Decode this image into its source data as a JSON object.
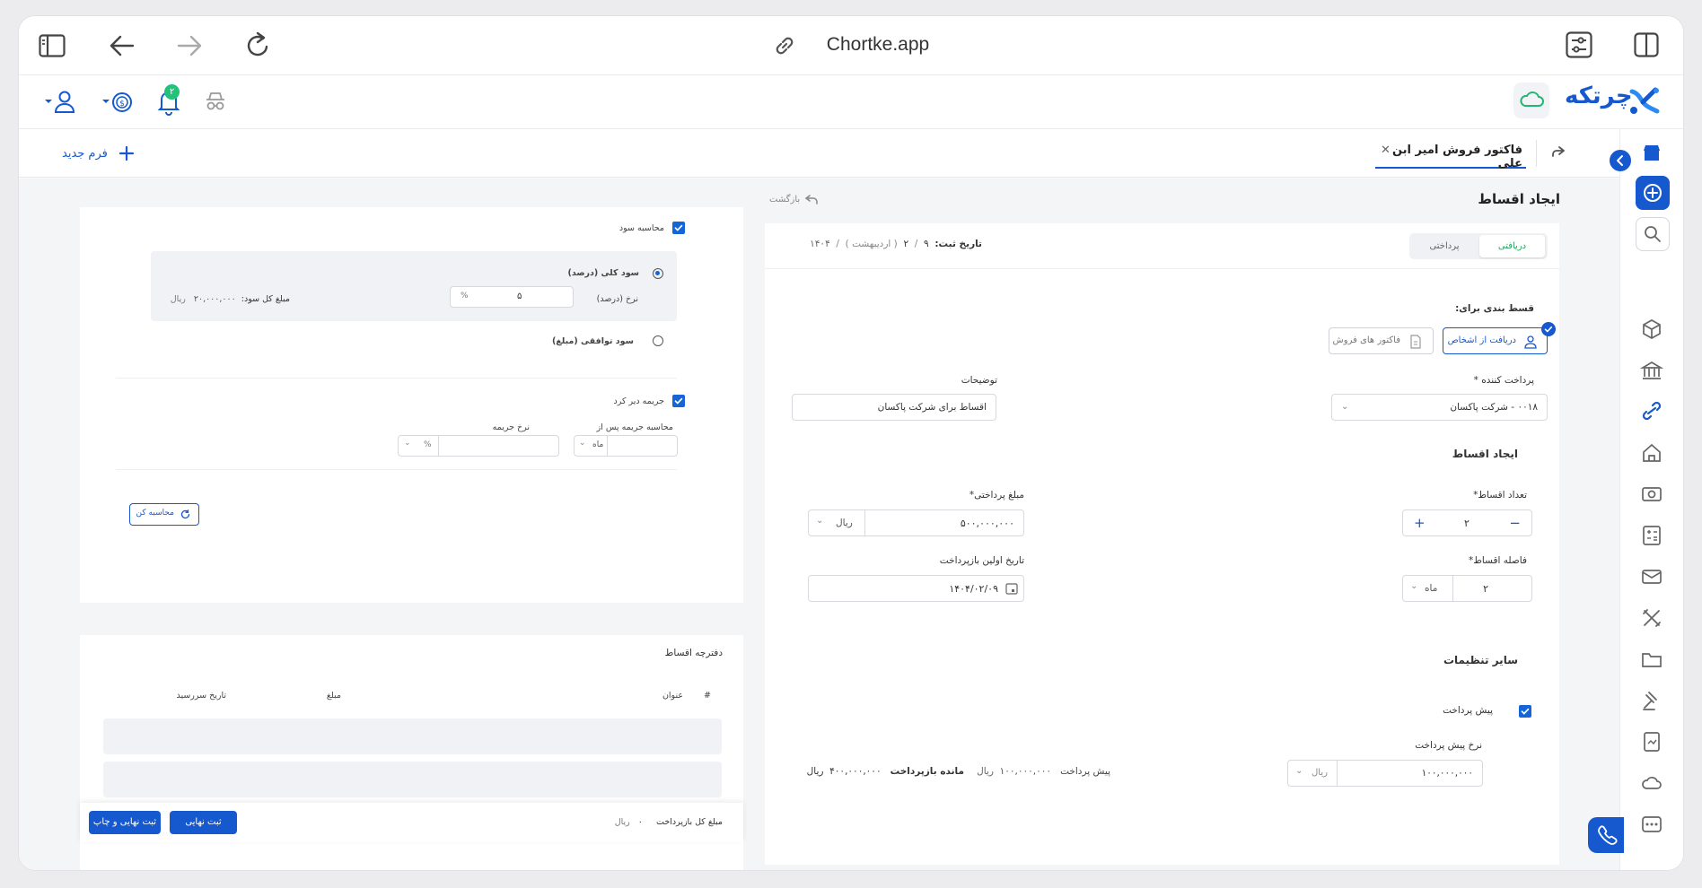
{
  "browser": {
    "url": "Chortke.app"
  },
  "app": {
    "logo_text": "چرتکه",
    "notification_badge": "۲",
    "colors": {
      "primary": "#1659cf",
      "accent": "#2b8bf0",
      "success": "#22b573"
    }
  },
  "tabs": {
    "active_label": "فاکتور فروش امیر ابن علی",
    "new_form_label": "فرم جدید"
  },
  "page": {
    "title": "ایجاد اقساط",
    "back_label": "بازگشت"
  },
  "main_form": {
    "segment": {
      "received": "دریافتی",
      "paid": "پرداختی"
    },
    "date": {
      "label": "تاریخ ثبت:",
      "day": "۹",
      "sep1": "/",
      "month": "۲",
      "month_name": "( اردیبهشت )",
      "sep2": "/",
      "year": "۱۴۰۴"
    },
    "installment_for": {
      "label": "قسط بندی برای:",
      "option_persons": "دریافت از اشخاص",
      "option_invoices": "فاکتور های فروش"
    },
    "payer": {
      "label": "پرداخت کننده *",
      "value": "۰۰۱۸ - شرکت پاکسان"
    },
    "description": {
      "label": "توضیحات",
      "value": "اقساط برای شرکت پاکسان"
    },
    "create_section_title": "ایجاد اقساط",
    "count": {
      "label": "تعداد اقساط*",
      "value": "۲"
    },
    "amount": {
      "label": "مبلغ پرداختی*",
      "value": "۵۰۰,۰۰۰,۰۰۰",
      "unit": "ریال"
    },
    "interval": {
      "label": "فاصله اقساط*",
      "value": "۲",
      "unit": "ماه"
    },
    "first_due": {
      "label": "تاریخ اولین بازپرداخت",
      "value": "۱۴۰۴/۰۲/۰۹"
    },
    "other_settings_title": "سایر تنظیمات",
    "prepayment": {
      "label": "پیش پرداخت"
    },
    "prepayment_rate": {
      "label": "نرخ پیش پرداخت",
      "value": "۱۰۰,۰۰۰,۰۰۰",
      "unit": "ریال"
    },
    "summary": {
      "prepay_label": "پیش پرداخت",
      "prepay_value": "۱۰۰,۰۰۰,۰۰۰",
      "prepay_unit": "ریال",
      "remaining_label": "مانده بازپرداخت",
      "remaining_value": "۴۰۰,۰۰۰,۰۰۰",
      "remaining_unit": "ریال"
    }
  },
  "profit_panel": {
    "calc_profit_label": "محاسبه سود",
    "total_profit_label": "سود کلی (درصد)",
    "rate_label": "نرخ (درصد)",
    "rate_value": "۵",
    "rate_unit": "%",
    "total_profit_amount_label": "مبلغ کل سود:",
    "total_profit_amount_value": "۲۰,۰۰۰,۰۰۰",
    "total_profit_amount_unit": "ریال",
    "agreed_profit_label": "سود توافقی (مبلغ)",
    "late_penalty_label": "جریمه دیر کرد",
    "penalty_after_label": "محاسبه جریمه پس از",
    "penalty_after_unit": "ماه",
    "penalty_rate_label": "نرخ جریمه",
    "penalty_rate_unit": "%",
    "calculate_button": "محاسبه کن"
  },
  "schedule": {
    "title": "دفترچه اقساط",
    "columns": {
      "index": "#",
      "title": "عنوان",
      "amount": "مبلغ",
      "due": "تاریخ سررسید"
    }
  },
  "footer": {
    "total_label": "مبلغ کل بازپرداخت",
    "total_value": "۰",
    "total_unit": "ریال",
    "submit_label": "ثبت نهایی",
    "submit_print_label": "ثبت نهایی و چاپ"
  }
}
